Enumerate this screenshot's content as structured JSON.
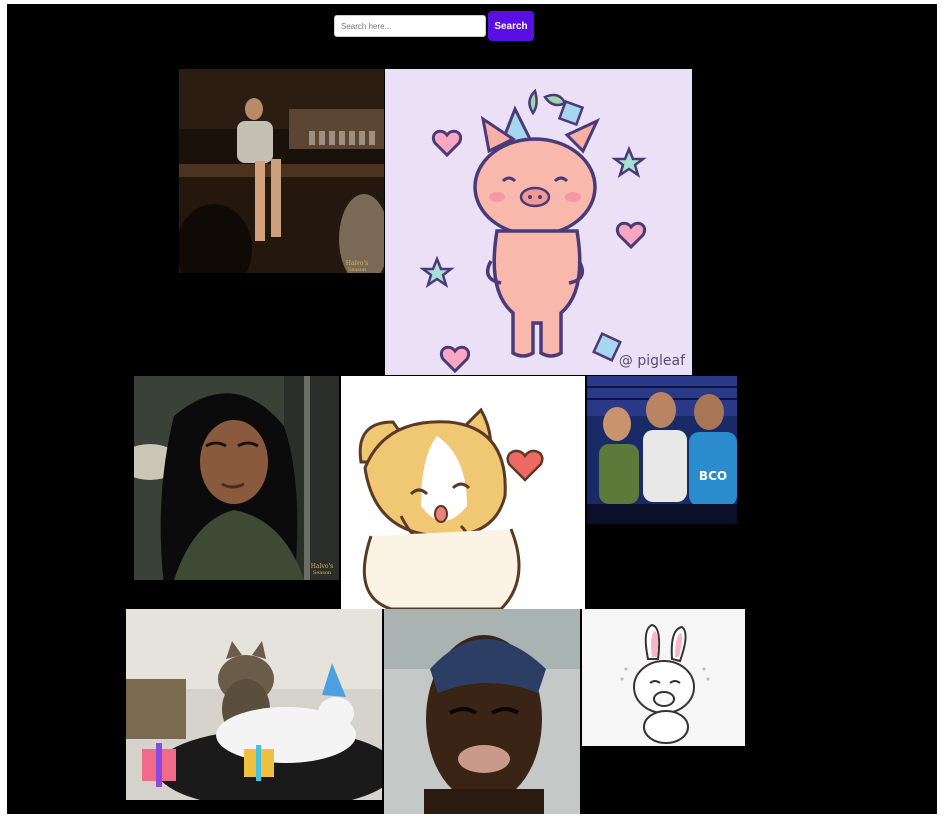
{
  "search": {
    "placeholder": "Search here...",
    "value": "",
    "button_label": "Search"
  },
  "gifs": [
    {
      "id": 1,
      "subject": "woman-in-bar",
      "watermark": "Halvo's\nSeason",
      "accent": "#4a2e18"
    },
    {
      "id": 2,
      "subject": "pig-with-party-hat",
      "watermark": "@ pigleaf",
      "accent": "#ece0f7"
    },
    {
      "id": 3,
      "subject": "dark-haired-woman",
      "watermark": "Halvo's\nSeason",
      "accent": "#44503a"
    },
    {
      "id": 4,
      "subject": "shiba-hearts",
      "watermark": "",
      "accent": "#f0c772"
    },
    {
      "id": 5,
      "subject": "men-in-stadium",
      "watermark": "",
      "accent": "#1e4a9a"
    },
    {
      "id": 6,
      "subject": "cats-birthday",
      "watermark": "",
      "accent": "#d9d9d9"
    },
    {
      "id": 7,
      "subject": "man-durag",
      "watermark": "",
      "accent": "#3b4a6a"
    },
    {
      "id": 8,
      "subject": "bunny-cony",
      "watermark": "",
      "accent": "#f4f4f4"
    }
  ]
}
